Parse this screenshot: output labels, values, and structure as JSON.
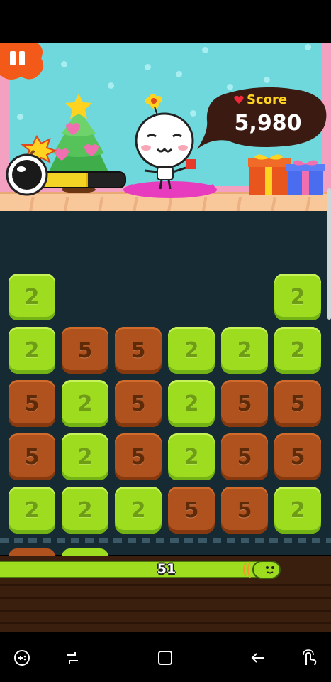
{
  "hud": {
    "score_label": "Score",
    "score_value": "5,980",
    "bomb_meter_fraction": 0.55
  },
  "board": {
    "rows": [
      [
        "2",
        "",
        "",
        "",
        "",
        "2"
      ],
      [
        "2",
        "5",
        "5",
        "2",
        "2",
        "2"
      ],
      [
        "5",
        "2",
        "5",
        "2",
        "5",
        "5"
      ],
      [
        "5",
        "2",
        "5",
        "2",
        "5",
        "5"
      ],
      [
        "2",
        "2",
        "2",
        "5",
        "5",
        "2"
      ]
    ]
  },
  "progress": {
    "value_label": "51"
  },
  "colors": {
    "tile_green": "#9edc1f",
    "tile_brown": "#b0521d",
    "board_bg": "#162a33",
    "sky": "#6ed8dd",
    "score_bubble": "#3b1a12",
    "pause_button": "#f35a1a"
  },
  "icons": {
    "pause": "pause-icon",
    "bomb": "bomb-icon",
    "heart": "heart-icon",
    "nav": [
      "game-tools-icon",
      "recent-apps-icon",
      "home-icon",
      "back-icon",
      "touch-icon"
    ]
  }
}
